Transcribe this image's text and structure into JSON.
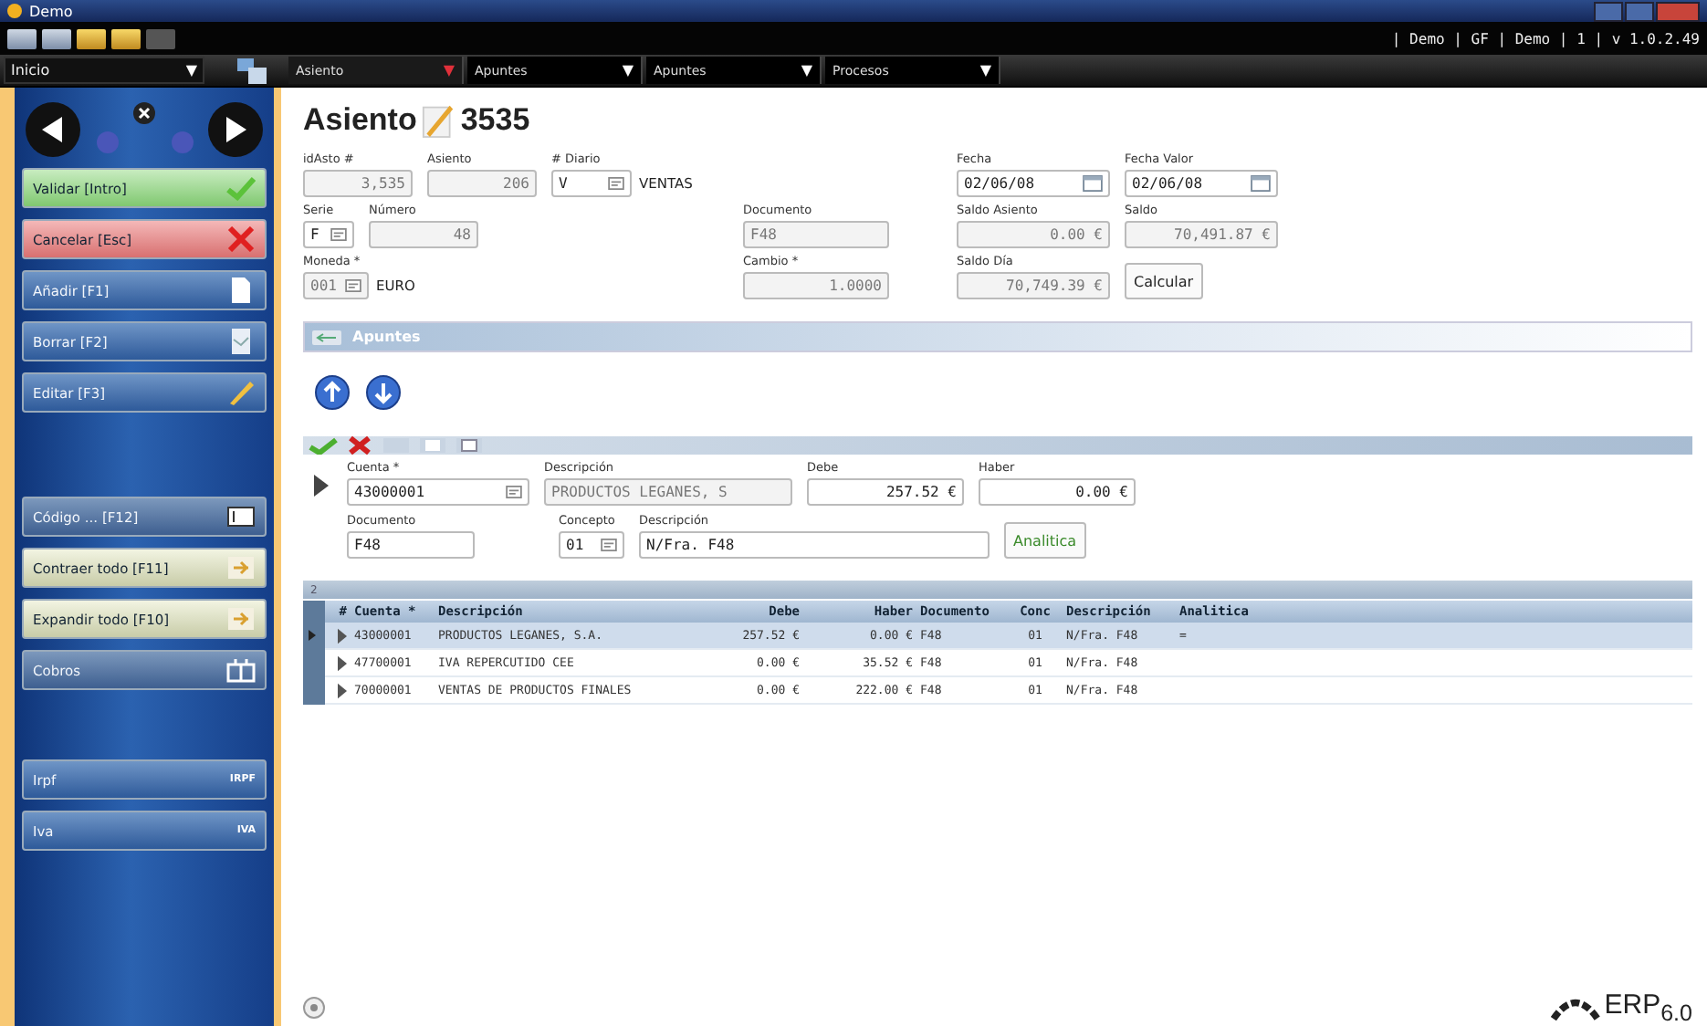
{
  "window": {
    "title": "Demo"
  },
  "session_info": "| Demo | GF | Demo | 1 | v 1.0.2.49",
  "module_menu": {
    "label": "Inicio",
    "caret": "▼"
  },
  "tabs": [
    {
      "label": "Asiento",
      "caret": "▼",
      "selected": true
    },
    {
      "label": "Apuntes",
      "caret": "▼",
      "selected": false
    },
    {
      "label": "Apuntes",
      "caret": "▼",
      "selected": false
    },
    {
      "label": "Procesos",
      "caret": "▼",
      "selected": false
    }
  ],
  "sidebar": {
    "actions": [
      {
        "label": "Validar [Intro]",
        "kind": "accept",
        "disabled": false
      },
      {
        "label": "Cancelar [Esc]",
        "kind": "cancel",
        "disabled": false
      },
      {
        "label": "Añadir [F1]",
        "kind": "add",
        "disabled": true
      },
      {
        "label": "Borrar [F2]",
        "kind": "delete",
        "disabled": true
      },
      {
        "label": "Editar [F3]",
        "kind": "edit",
        "disabled": true
      }
    ],
    "tools": [
      {
        "label": "Código ... [F12]",
        "kind": "code",
        "disabled": true
      },
      {
        "label": "Contraer todo [F11]",
        "kind": "collapse",
        "disabled": false
      },
      {
        "label": "Expandir todo [F10]",
        "kind": "expand",
        "disabled": false
      },
      {
        "label": "Cobros",
        "kind": "payments",
        "disabled": true
      }
    ],
    "taxes": [
      {
        "label": "Irpf",
        "tag": "IRPF"
      },
      {
        "label": "Iva",
        "tag": "IVA"
      }
    ]
  },
  "header": {
    "title": "Asiento",
    "number": "3535"
  },
  "fields": {
    "id_asto": {
      "label": "idAsto #",
      "value": "3,535",
      "disabled": true
    },
    "asiento": {
      "label": "Asiento",
      "value": "206",
      "disabled": true
    },
    "diario": {
      "label": "# Diario",
      "value": "V",
      "name": "VENTAS"
    },
    "fecha": {
      "label": "Fecha",
      "value": "02/06/08"
    },
    "fecha_valor": {
      "label": "Fecha Valor",
      "value": "02/06/08"
    },
    "serie": {
      "label": "Serie",
      "value": "F"
    },
    "numero": {
      "label": "Número",
      "value": "48",
      "disabled": true
    },
    "documento": {
      "label": "Documento",
      "value": "F48",
      "disabled": true
    },
    "saldo_asiento": {
      "label": "Saldo Asiento",
      "value": "0.00 €",
      "disabled": true
    },
    "saldo": {
      "label": "Saldo",
      "value": "70,491.87 €",
      "disabled": true
    },
    "moneda": {
      "label": "Moneda *",
      "value": "001",
      "name": "EURO"
    },
    "cambio": {
      "label": "Cambio *",
      "value": "1.0000",
      "disabled": true
    },
    "saldo_dia": {
      "label": "Saldo Día",
      "value": "70,749.39 €",
      "disabled": true
    }
  },
  "calculate_button": "Calcular",
  "section": {
    "title": "Apuntes"
  },
  "entry": {
    "cuenta": {
      "label": "Cuenta *",
      "value": "43000001",
      "disabled": false
    },
    "descripcion": {
      "label": "Descripción",
      "value": "PRODUCTOS LEGANES, S",
      "disabled": true
    },
    "debe": {
      "label": "Debe",
      "value": "257.52 €",
      "disabled": false
    },
    "haber": {
      "label": "Haber",
      "value": "0.00 €",
      "disabled": false
    },
    "documento": {
      "label": "Documento",
      "value": "F48",
      "disabled": false
    },
    "concepto": {
      "label": "Concepto",
      "value": "01",
      "disabled": false
    },
    "descripcion2": {
      "label": "Descripción",
      "value": "N/Fra. F48",
      "disabled": false
    }
  },
  "analytics_button": "Analitica",
  "grid": {
    "group_label": "2",
    "columns": [
      "#",
      "Cuenta *",
      "Descripción",
      "Debe",
      "Haber",
      "Documento",
      "Conc",
      "Descripción",
      "Analitica"
    ],
    "rows": [
      {
        "selected": true,
        "cells": [
          "",
          "43000001",
          "PRODUCTOS LEGANES, S.A.",
          "257.52 €",
          "0.00 €",
          "F48",
          "01",
          "N/Fra. F48",
          "="
        ]
      },
      {
        "selected": false,
        "cells": [
          "",
          "47700001",
          "IVA REPERCUTIDO CEE",
          "0.00 €",
          "35.52 €",
          "F48",
          "01",
          "N/Fra. F48",
          ""
        ]
      },
      {
        "selected": false,
        "cells": [
          "",
          "70000001",
          "VENTAS DE PRODUCTOS FINALES",
          "0.00 €",
          "222.00 €",
          "F48",
          "01",
          "N/Fra. F48",
          ""
        ]
      }
    ]
  },
  "logo": {
    "text": "ERP$_{6.0}$"
  }
}
